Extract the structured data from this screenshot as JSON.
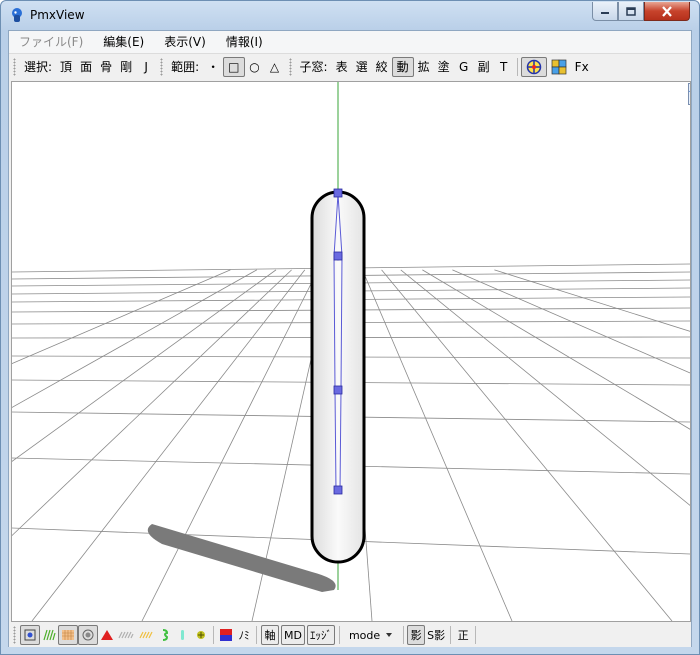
{
  "window": {
    "title": "PmxView"
  },
  "menubar": {
    "items": [
      {
        "label": "ファイル(F)",
        "disabled": true
      },
      {
        "label": "編集(E)",
        "disabled": false
      },
      {
        "label": "表示(V)",
        "disabled": false
      },
      {
        "label": "情報(I)",
        "disabled": false
      }
    ]
  },
  "toolbar": {
    "select_label": "選択:",
    "select_items": [
      "頂",
      "面",
      "骨",
      "剛",
      "J"
    ],
    "range_label": "範囲:",
    "range_items": [
      "・",
      "□",
      "○",
      "△"
    ],
    "child_label": "子窓:",
    "child_items": [
      "表",
      "選",
      "絞",
      "動",
      "拡",
      "塗",
      "G",
      "副",
      "T"
    ],
    "fx_label": "Fx"
  },
  "bottombar": {
    "nomi_label": "ﾉﾐ",
    "axis_label": "軸",
    "md_label": "MD",
    "edge_label": "ｴｯｼﾞ",
    "mode_label": "mode",
    "shadow_label": "影",
    "sshadow_label": "S影",
    "sei_label": "正"
  },
  "icons": {
    "app": "pmxview-app-icon",
    "nav": [
      "move-view-icon",
      "pan-view-icon",
      "zoom-view-icon",
      "rotate-view-icon"
    ]
  },
  "colors": {
    "accent_blue": "#2a6fd6",
    "bone_color": "#5b5bd6",
    "axis_green": "#3aa63a"
  }
}
